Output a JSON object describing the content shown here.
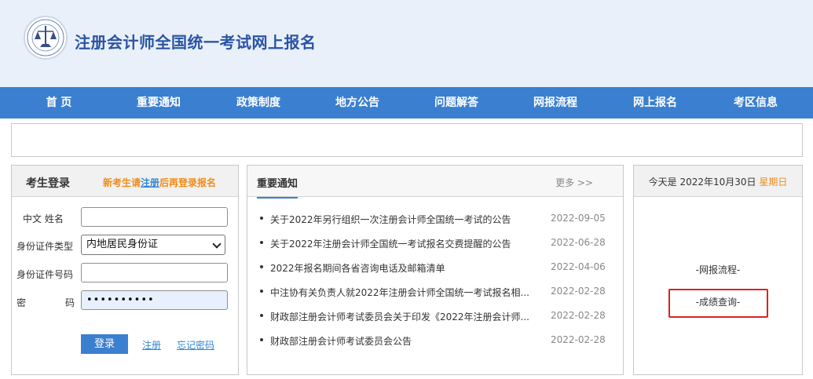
{
  "header": {
    "site_title": "注册会计师全国统一考试网上报名",
    "logo_icon": "cicpa-emblem-icon"
  },
  "nav": {
    "items": [
      "首 页",
      "重要通知",
      "政策制度",
      "地方公告",
      "问题解答",
      "网报流程",
      "网上报名",
      "考区信息"
    ]
  },
  "login": {
    "title": "考生登录",
    "hint_prefix": "新考生请",
    "hint_register": "注册",
    "hint_suffix": "后再登录报名",
    "name_label": "中文 姓名",
    "name_value": "",
    "id_type_label": "身份证件类型",
    "id_type_value": "内地居民身份证",
    "id_number_label": "身份证件号码",
    "id_number_value": "",
    "password_label_1": "密",
    "password_label_2": "码",
    "password_value": "••••••••••",
    "login_button": "登录",
    "register_link": "注册",
    "forgot_link": "忘记密码"
  },
  "notices": {
    "title": "重要通知",
    "more": "更多 >>",
    "items": [
      {
        "text": "关于2022年另行组织一次注册会计师全国统一考试的公告",
        "date": "2022-09-05"
      },
      {
        "text": "关于2022年注册会计师全国统一考试报名交费提醒的公告",
        "date": "2022-06-28"
      },
      {
        "text": "2022年报名期间各省咨询电话及邮箱清单",
        "date": "2022-04-06"
      },
      {
        "text": "中注协有关负责人就2022年注册会计师全国统一考试报名相...",
        "date": "2022-02-28"
      },
      {
        "text": "财政部注册会计师考试委员会关于印发《2022年注册会计师...",
        "date": "2022-02-28"
      },
      {
        "text": "财政部注册会计师考试委员会公告",
        "date": "2022-02-28"
      }
    ]
  },
  "today": {
    "prefix": "今天是 2022年10月30日",
    "weekday": "星期日",
    "process_link": "-网报流程-",
    "score_link": "-成绩查询-",
    "highlight_color": "#e02020"
  },
  "colors": {
    "nav_bg": "#3b7fd0",
    "title": "#2a54a4",
    "hint": "#f08c1a"
  }
}
